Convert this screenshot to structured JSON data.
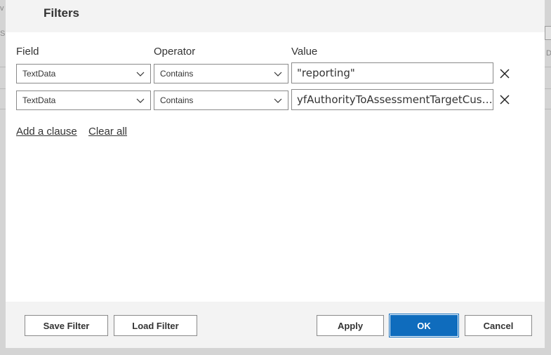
{
  "dialog": {
    "title": "Filters"
  },
  "columns": {
    "field": "Field",
    "operator": "Operator",
    "value": "Value"
  },
  "clauses": [
    {
      "field": "TextData",
      "operator": "Contains",
      "value": "\"reporting\""
    },
    {
      "field": "TextData",
      "operator": "Contains",
      "value": "yfAuthorityToAssessmentTargetCusto..."
    }
  ],
  "links": {
    "add_clause": "Add a clause",
    "clear_all": "Clear all"
  },
  "footer": {
    "save_filter": "Save Filter",
    "load_filter": "Load Filter",
    "apply": "Apply",
    "ok": "OK",
    "cancel": "Cancel"
  },
  "background": {
    "frag_v": "v",
    "frag_s": "S",
    "frag_d": "D"
  },
  "colors": {
    "accent": "#0f6cbd",
    "header_bg": "#f3f3f3"
  },
  "icons": {
    "dropdown": "chevron-down-icon",
    "remove": "close-icon"
  }
}
